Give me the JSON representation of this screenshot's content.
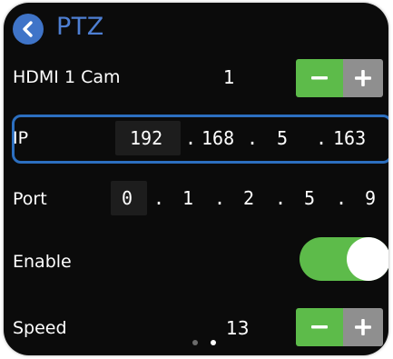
{
  "header": {
    "title": "PTZ"
  },
  "rows": {
    "hdmi": {
      "label": "HDMI 1 Cam",
      "value": "1"
    },
    "ip": {
      "label": "IP",
      "octets": [
        "192",
        "168",
        "5",
        "163"
      ],
      "separator": "."
    },
    "port": {
      "label": "Port",
      "digits": [
        "0",
        "1",
        "2",
        "5",
        "9"
      ],
      "separator": "."
    },
    "enable": {
      "label": "Enable",
      "state": "on"
    },
    "speed": {
      "label": "Speed",
      "value": "13"
    }
  },
  "controls": {
    "minus": "−",
    "plus": "+"
  },
  "colors": {
    "accent_blue": "#3f74c8",
    "title_blue": "#4e7fd3",
    "green": "#5dbb4a",
    "gray": "#8f8f8f",
    "selection_border": "#2c6fc0"
  }
}
